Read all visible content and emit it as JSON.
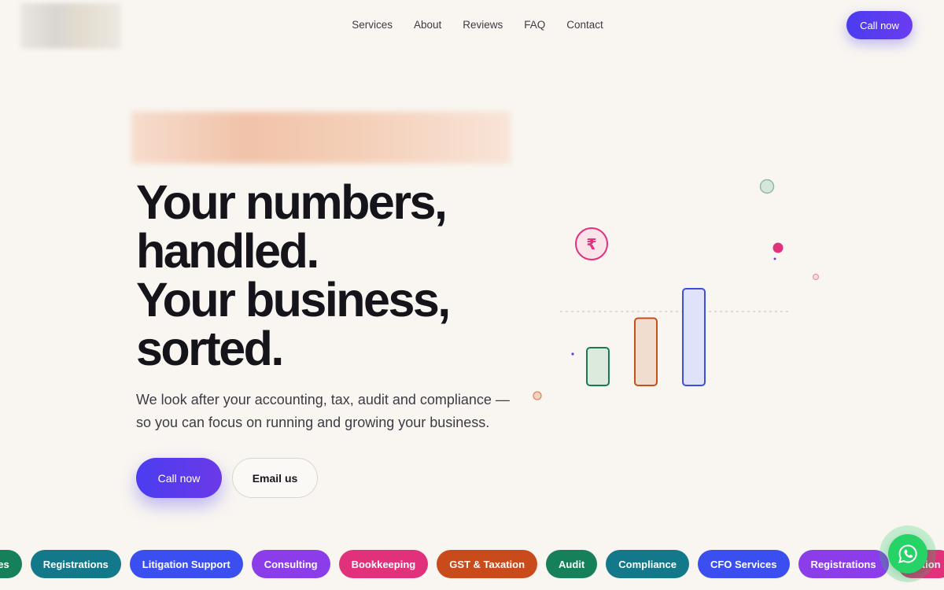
{
  "nav": {
    "items": [
      "Services",
      "About",
      "Reviews",
      "FAQ",
      "Contact"
    ],
    "call_label": "Call now"
  },
  "hero": {
    "headline": [
      "Your numbers,",
      "handled.",
      "Your business,",
      "sorted."
    ],
    "subtext": "We look after your accounting, tax, audit and compliance — so you can focus on running and growing your business.",
    "call_label": "Call now",
    "email_label": "Email us"
  },
  "illustration": {
    "currency_symbol": "₹",
    "bars": [
      {
        "level": 0.32,
        "stroke": "#1a7a4e",
        "fill": "#dce9dd"
      },
      {
        "level": 0.57,
        "stroke": "#c2511c",
        "fill": "#f1ddcf"
      },
      {
        "level": 0.82,
        "stroke": "#3b4fe0",
        "fill": "#dfe2f8"
      }
    ]
  },
  "chips": [
    {
      "label": "ces",
      "color": "#16805a"
    },
    {
      "label": "Registrations",
      "color": "#13788a"
    },
    {
      "label": "Litigation Support",
      "color": "#3b4ff0"
    },
    {
      "label": "Consulting",
      "color": "#8a3de8"
    },
    {
      "label": "Bookkeeping",
      "color": "#e0317a"
    },
    {
      "label": "GST & Taxation",
      "color": "#c94b1c"
    },
    {
      "label": "Audit",
      "color": "#16805a"
    },
    {
      "label": "Compliance",
      "color": "#13788a"
    },
    {
      "label": "CFO Services",
      "color": "#3b4ff0"
    },
    {
      "label": "Registrations",
      "color": "#8a3de8"
    },
    {
      "label": "gation",
      "color": "#e0317a"
    }
  ],
  "colors": {
    "accent": "#4b3cf0",
    "background": "#f9f6f1",
    "whatsapp": "#25d366"
  },
  "icons": {
    "floating": "whatsapp-icon",
    "coin": "rupee-icon"
  }
}
